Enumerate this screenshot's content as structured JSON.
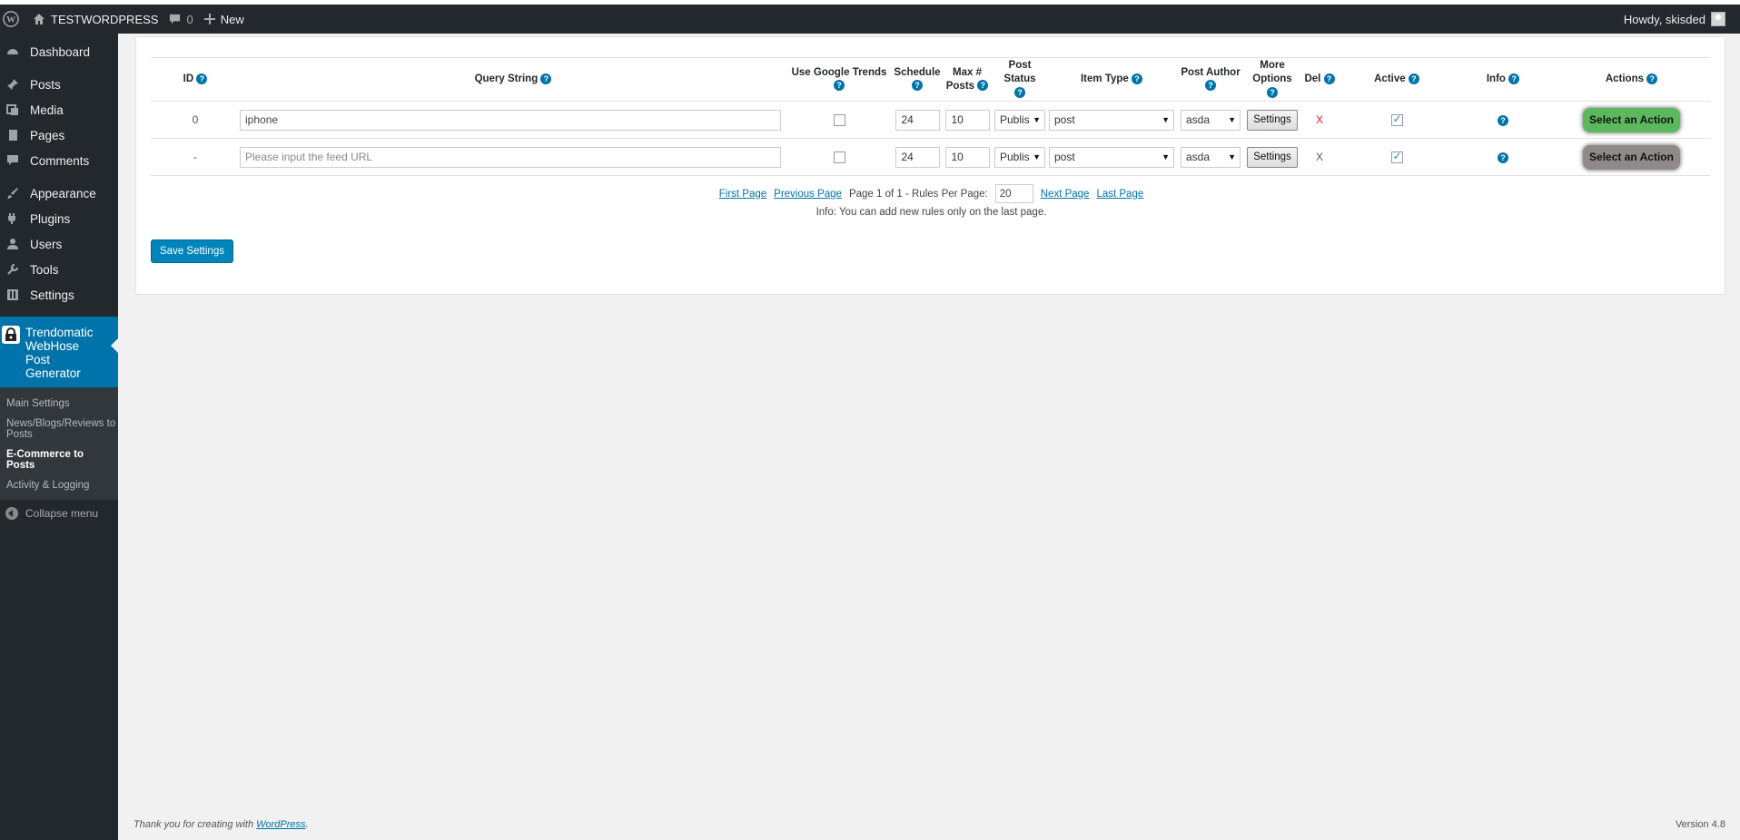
{
  "adminbar": {
    "site_name": "TESTWORDPRESS",
    "comments_count": "0",
    "new_label": "New",
    "howdy": "Howdy, skisded"
  },
  "sidebar": {
    "items": [
      {
        "label": "Dashboard",
        "icon": "dashboard-icon"
      },
      {
        "label": "Posts",
        "icon": "pin-icon"
      },
      {
        "label": "Media",
        "icon": "media-icon"
      },
      {
        "label": "Pages",
        "icon": "page-icon"
      },
      {
        "label": "Comments",
        "icon": "comment-icon"
      },
      {
        "label": "Appearance",
        "icon": "brush-icon"
      },
      {
        "label": "Plugins",
        "icon": "plug-icon"
      },
      {
        "label": "Users",
        "icon": "user-icon"
      },
      {
        "label": "Tools",
        "icon": "wrench-icon"
      },
      {
        "label": "Settings",
        "icon": "settings-icon"
      }
    ],
    "current_plugin": "Trendomatic WebHose Post Generator",
    "submenu": [
      {
        "label": "Main Settings"
      },
      {
        "label": "News/Blogs/Reviews to Posts"
      },
      {
        "label": "E-Commerce to Posts"
      },
      {
        "label": "Activity & Logging"
      }
    ],
    "collapse_label": "Collapse menu"
  },
  "table": {
    "headers": {
      "id": "ID",
      "query": "Query String",
      "google_trends": "Use Google Trends",
      "schedule": "Schedule",
      "max_posts_1": "Max #",
      "max_posts_2": "Posts",
      "post_status": "Post Status",
      "item_type": "Item Type",
      "post_author": "Post Author",
      "more_options_1": "More",
      "more_options_2": "Options",
      "del": "Del",
      "active": "Active",
      "info": "Info",
      "actions": "Actions"
    },
    "rows": [
      {
        "id": "0",
        "query": "iphone",
        "schedule": "24",
        "max_posts": "10",
        "post_status": "Publis",
        "item_type": "post",
        "author": "asda",
        "settings": "Settings",
        "del": "X",
        "action": "Select an Action"
      },
      {
        "id": "-",
        "query_placeholder": "Please input the feed URL",
        "schedule": "24",
        "max_posts": "10",
        "post_status": "Publis",
        "item_type": "post",
        "author": "asda",
        "settings": "Settings",
        "del": "X",
        "action": "Select an Action"
      }
    ],
    "help_glyph": "?"
  },
  "pager": {
    "first": "First Page",
    "previous": "Previous Page",
    "status": "Page 1 of 1 - Rules Per Page:",
    "per_page": "20",
    "next": "Next Page",
    "last": "Last Page",
    "info": "Info: You can add new rules only on the last page."
  },
  "save_label": "Save Settings",
  "footer": {
    "thanks_prefix": "Thank you for creating with",
    "wordpress_link": "WordPress",
    "thanks_suffix": ".",
    "version": "Version 4.8"
  },
  "colors": {
    "adminbar_bg": "#23282d",
    "accent": "#0073aa",
    "action_green": "#5cb85c",
    "action_gray": "#8e8a8a",
    "del_red": "#e02020"
  }
}
